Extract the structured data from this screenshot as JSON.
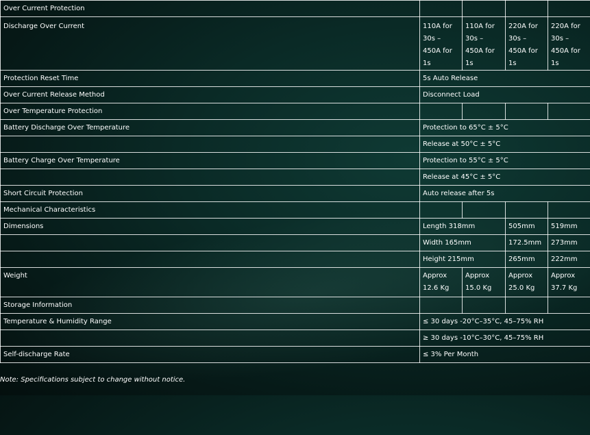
{
  "rows": [
    {
      "label": "Over Current Protection",
      "cells": [
        "",
        "",
        "",
        ""
      ]
    },
    {
      "label": "Discharge Over Current",
      "cells": [
        "110A for 30s – 450A for 1s",
        "110A for 30s – 450A for 1s",
        "220A for 30s – 450A for 1s",
        "220A for 30s – 450A for 1s"
      ]
    },
    {
      "label": "Protection Reset Time",
      "span": "5s Auto Release"
    },
    {
      "label": "Over Current Release Method",
      "span": "Disconnect Load"
    },
    {
      "label": "Over Temperature Protection",
      "cells": [
        "",
        "",
        "",
        ""
      ]
    },
    {
      "label": "Battery Discharge Over Temperature",
      "span": "Protection to 65°C ± 5°C"
    },
    {
      "label": "",
      "span": "Release at 50°C ± 5°C"
    },
    {
      "label": "Battery Charge Over Temperature",
      "span": "Protection to 55°C ± 5°C"
    },
    {
      "label": "",
      "span": "Release at 45°C ± 5°C"
    },
    {
      "label": "Short Circuit Protection",
      "span": "Auto release after 5s"
    },
    {
      "label": "Mechanical Characteristics",
      "cells": [
        "",
        "",
        "",
        ""
      ]
    },
    {
      "label": "Dimensions",
      "c12": "Length 318mm",
      "c3": "505mm",
      "c4": "519mm"
    },
    {
      "label": "",
      "c12": "Width 165mm",
      "c3": "172.5mm",
      "c4": "273mm"
    },
    {
      "label": "",
      "c12": "Height 215mm",
      "c3": "265mm",
      "c4": "222mm"
    },
    {
      "label": "Weight",
      "cells": [
        "Approx 12.6 Kg",
        "Approx 15.0 Kg",
        "Approx 25.0 Kg",
        "Approx 37.7 Kg"
      ]
    },
    {
      "label": "Storage Information",
      "cells": [
        "",
        "",
        "",
        ""
      ]
    },
    {
      "label": "Temperature & Humidity Range",
      "span": "≤ 30 days -20°C–35°C, 45–75% RH"
    },
    {
      "label": "",
      "span": "≥ 30 days -10°C–30°C, 45–75% RH"
    },
    {
      "label": "Self-discharge Rate",
      "span": "≤ 3% Per Month"
    }
  ],
  "note": "Note: Specifications subject to change without notice."
}
